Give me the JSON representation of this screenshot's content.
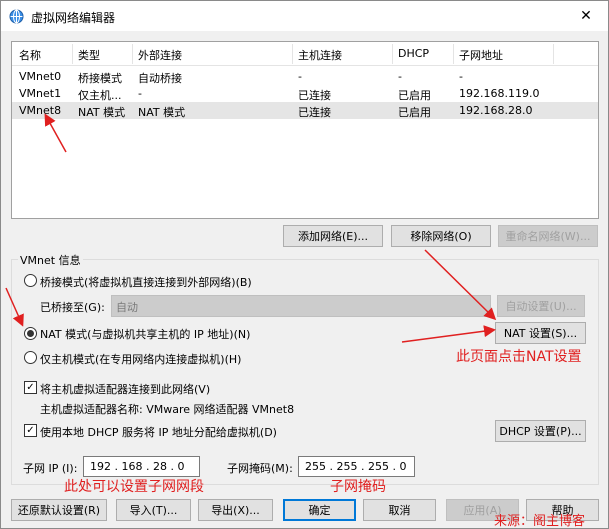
{
  "window": {
    "title": "虚拟网络编辑器",
    "close_glyph": "✕"
  },
  "list": {
    "columns": [
      "名称",
      "类型",
      "外部连接",
      "主机连接",
      "DHCP",
      "子网地址"
    ],
    "rows": [
      [
        "VMnet0",
        "桥接模式",
        "自动桥接",
        "-",
        "-",
        "-"
      ],
      [
        "VMnet1",
        "仅主机...",
        "-",
        "已连接",
        "已启用",
        "192.168.119.0"
      ],
      [
        "VMnet8",
        "NAT 模式",
        "NAT 模式",
        "已连接",
        "已启用",
        "192.168.28.0"
      ]
    ],
    "selected_row": 2
  },
  "buttons_mid": {
    "add": "添加网络(E)...",
    "remove": "移除网络(O)",
    "rename": "重命名网络(W)..."
  },
  "vmnet_info": {
    "label": "VMnet 信息",
    "bridge_mode": "桥接模式(将虚拟机直接连接到外部网络)(B)",
    "bridged_to_label": "已桥接至(G):",
    "bridged_to_value": "自动",
    "auto_settings": "自动设置(U)...",
    "nat_mode": "NAT 模式(与虚拟机共享主机的 IP 地址)(N)",
    "nat_settings": "NAT 设置(S)...",
    "host_only": "仅主机模式(在专用网络内连接虚拟机)(H)",
    "connect_adapter": "将主机虚拟适配器连接到此网络(V)",
    "adapter_name": "主机虚拟适配器名称: VMware 网络适配器 VMnet8",
    "use_dhcp": "使用本地 DHCP 服务将 IP 地址分配给虚拟机(D)",
    "dhcp_settings": "DHCP 设置(P)...",
    "subnet_ip_label": "子网 IP (I):",
    "subnet_ip": "192 . 168 . 28 . 0",
    "subnet_mask_label": "子网掩码(M):",
    "subnet_mask": "255 . 255 . 255 . 0"
  },
  "footer": {
    "restore": "还原默认设置(R)",
    "import": "导入(T)...",
    "export": "导出(X)...",
    "ok": "确定",
    "cancel": "取消",
    "apply": "应用(A)",
    "help": "帮助"
  },
  "annotations": {
    "nat_note": "此页面点击NAT设置",
    "subnet_note": "此处可以设置子网网段",
    "mask_note": "子网掩码",
    "source_note": "来源：阁主博客",
    "color": "#e02020"
  }
}
